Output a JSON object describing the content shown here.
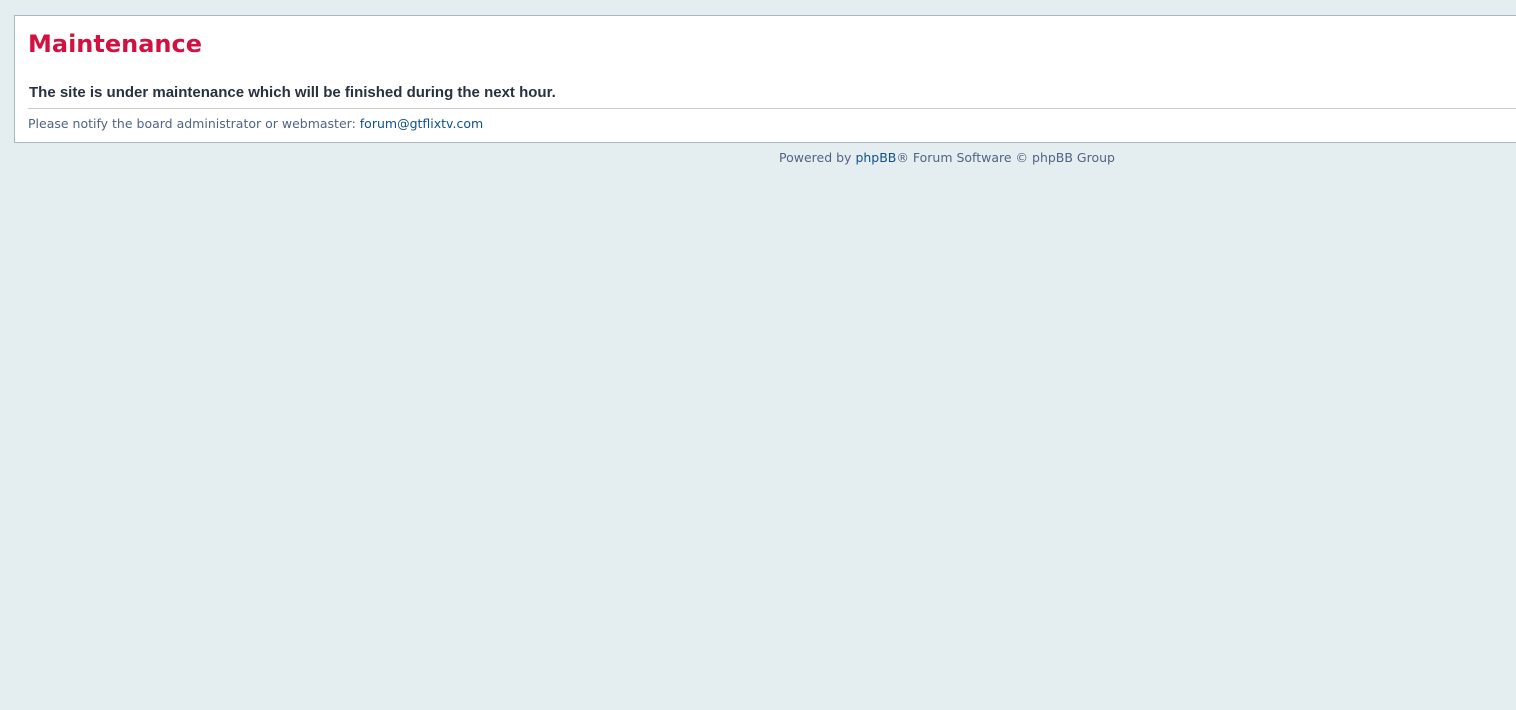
{
  "panel": {
    "title": "Maintenance",
    "message": "The site is under maintenance which will be finished during the next hour.",
    "notice_prefix": "Please notify the board administrator or webmaster:",
    "contact_email": "forum@gtflixtv.com"
  },
  "footer": {
    "powered_by": "Powered by",
    "phpbb_link": "phpBB",
    "suffix": "® Forum Software © phpBB Group"
  },
  "colors": {
    "background": "#e4edf0",
    "title": "#d31141",
    "link": "#105289",
    "muted_text": "#536482"
  }
}
